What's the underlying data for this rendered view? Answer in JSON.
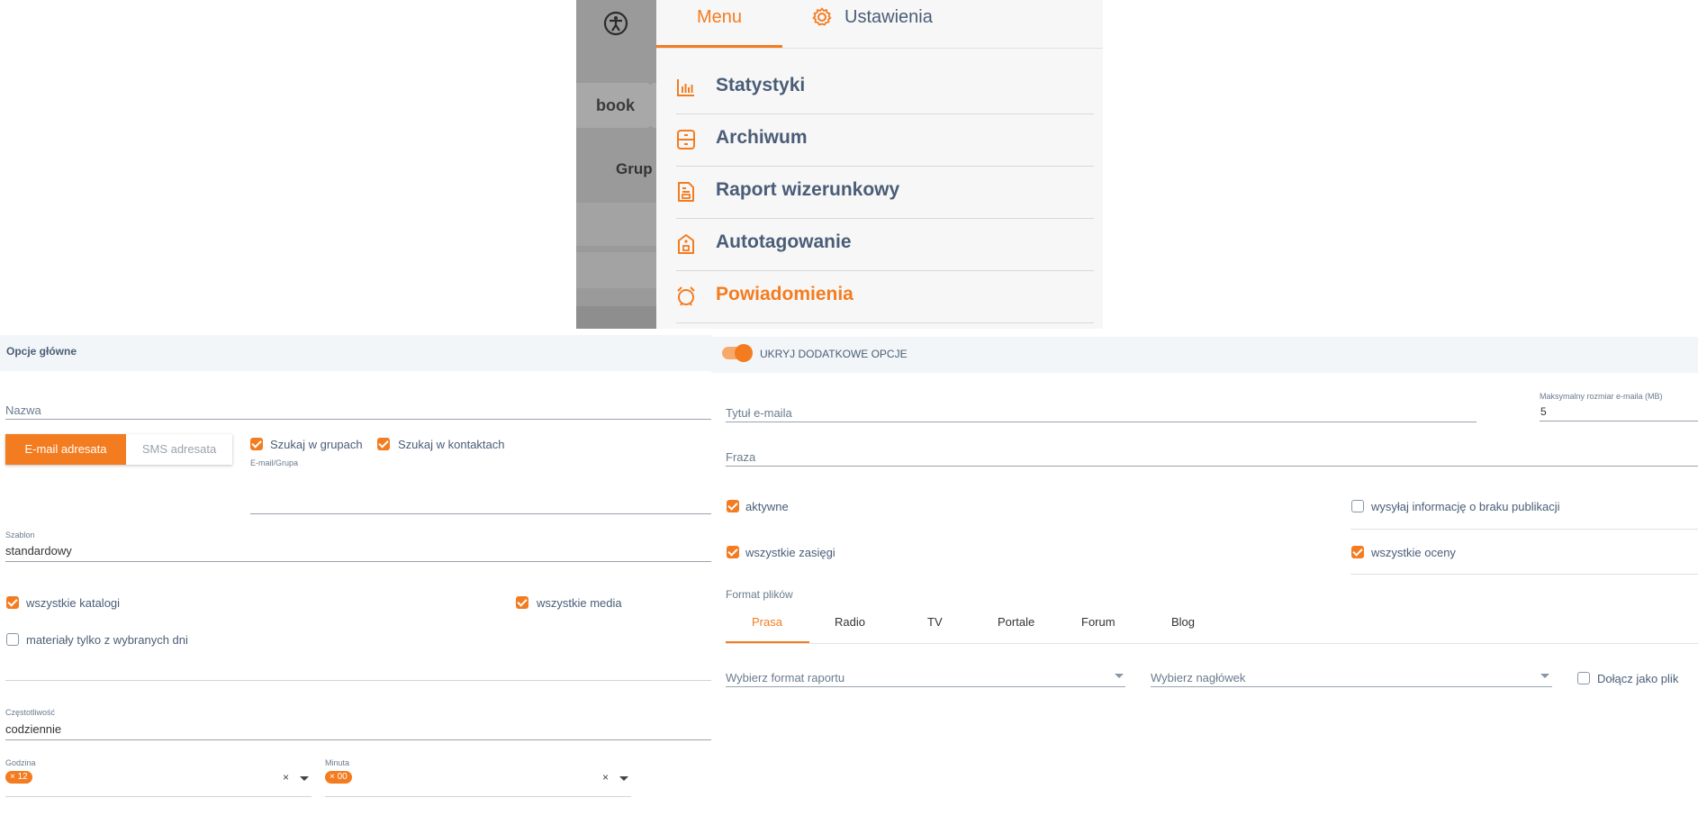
{
  "menu": {
    "tabs": {
      "menu": "Menu",
      "settings": "Ustawienia"
    },
    "items": [
      {
        "label": "Statystyki",
        "icon": "chart-icon"
      },
      {
        "label": "Archiwum",
        "icon": "archive-icon"
      },
      {
        "label": "Raport wizerunkowy",
        "icon": "report-icon"
      },
      {
        "label": "Autotagowanie",
        "icon": "tag-icon"
      },
      {
        "label": "Powiadomienia",
        "icon": "alarm-icon",
        "active": true
      }
    ],
    "background": {
      "pill_text": "book",
      "group_text": "Grup"
    }
  },
  "left": {
    "header": "Opcje główne",
    "name_label": "Nazwa",
    "recipient": {
      "email": "E-mail adresata",
      "sms": "SMS adresata"
    },
    "search_groups": "Szukaj w grupach",
    "search_contacts": "Szukaj w kontaktach",
    "email_group_label": "E-mail/Grupa",
    "template_label": "Szablon",
    "template_value": "standardowy",
    "all_catalogs": "wszystkie katalogi",
    "all_media": "wszystkie media",
    "selected_days": "materiały tylko z wybranych dni",
    "frequency_label": "Częstotliwość",
    "frequency_value": "codziennie",
    "hour_label": "Godzina",
    "hour_value": "12",
    "minute_label": "Minuta",
    "minute_value": "00",
    "clear": "×"
  },
  "right": {
    "toggle_label": "UKRYJ DODATKOWE OPCJE",
    "email_title_label": "Tytuł e-maila",
    "max_size_label": "Maksymalny rozmiar e-maila (MB)",
    "max_size_value": "5",
    "phrase_label": "Fraza",
    "active": "aktywne",
    "no_publication": "wysyłaj informację o braku publikacji",
    "all_reach": "wszystkie zasięgi",
    "all_ratings": "wszystkie oceny",
    "file_format_label": "Format plików",
    "format_tabs": [
      "Prasa",
      "Radio",
      "TV",
      "Portale",
      "Forum",
      "Blog"
    ],
    "report_format_placeholder": "Wybierz format raportu",
    "header_placeholder": "Wybierz nagłówek",
    "attach_file": "Dołącz jako plik"
  },
  "colors": {
    "accent": "#f47c20",
    "text": "#4a5d77"
  }
}
